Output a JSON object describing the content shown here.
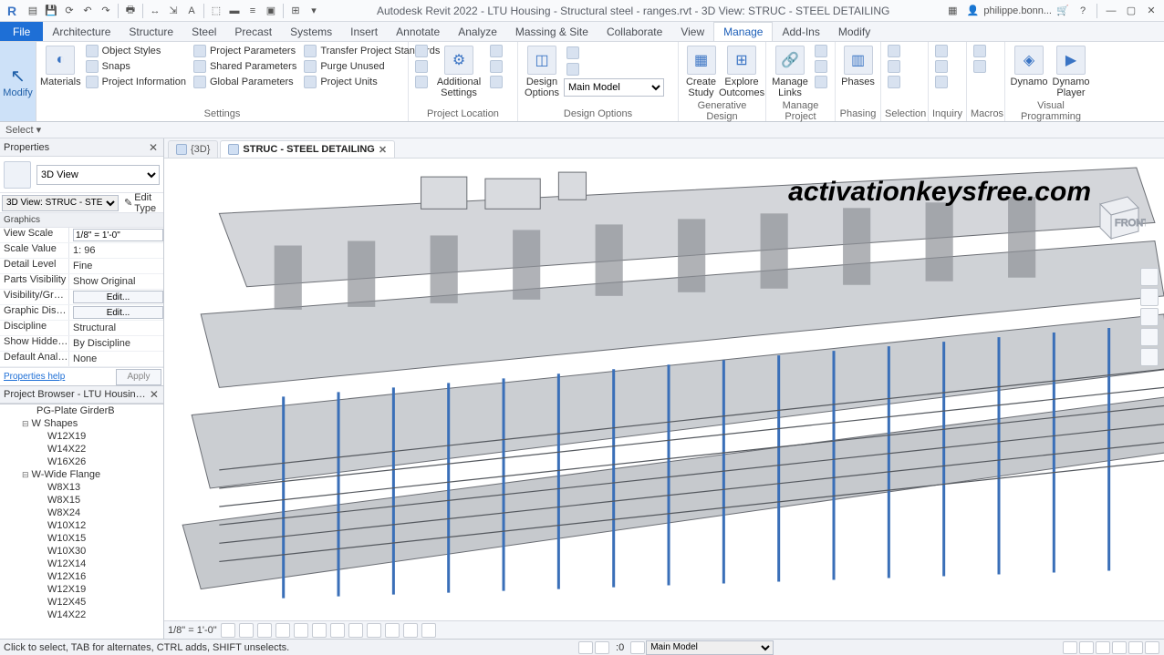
{
  "app": {
    "title": "Autodesk Revit 2022 - LTU Housing - Structural steel - ranges.rvt - 3D View: STRUC - STEEL DETAILING",
    "user": "philippe.bonn..."
  },
  "qat_icons": [
    "open",
    "save",
    "undo",
    "redo",
    "print",
    "measure",
    "dim",
    "text",
    "3d",
    "section",
    "thin",
    "close",
    "sync",
    "dropdown"
  ],
  "ribbon_tabs": [
    "Architecture",
    "Structure",
    "Steel",
    "Precast",
    "Systems",
    "Insert",
    "Annotate",
    "Analyze",
    "Massing & Site",
    "Collaborate",
    "View",
    "Manage",
    "Add-Ins",
    "Modify"
  ],
  "active_tab": "Manage",
  "file_tab": "File",
  "modify": {
    "label": "Modify",
    "select": "Select ▾"
  },
  "ribbon_panels": {
    "settings": {
      "title": "Settings",
      "materials": "Materials",
      "rows": [
        {
          "icon": "styles",
          "label": "Object  Styles"
        },
        {
          "icon": "snaps",
          "label": "Snaps"
        },
        {
          "icon": "info",
          "label": "Project  Information"
        },
        {
          "icon": "pparams",
          "label": "Project  Parameters"
        },
        {
          "icon": "sparams",
          "label": "Shared  Parameters"
        },
        {
          "icon": "gparams",
          "label": "Global  Parameters"
        },
        {
          "icon": "transfer",
          "label": "Transfer  Project Standards"
        },
        {
          "icon": "purge",
          "label": "Purge  Unused"
        },
        {
          "icon": "units",
          "label": "Project  Units"
        }
      ]
    },
    "project_location": {
      "title": "Project Location",
      "additional": "Additional\nSettings"
    },
    "design_options": {
      "title": "Design Options",
      "design": "Design\nOptions",
      "model": "Main Model"
    },
    "generative": {
      "title": "Generative Design",
      "create": "Create\nStudy",
      "explore": "Explore\nOutcomes"
    },
    "manage_project": {
      "title": "Manage Project",
      "links": "Manage\nLinks"
    },
    "phasing": {
      "title": "Phasing",
      "phases": "Phases"
    },
    "selection": {
      "title": "Selection"
    },
    "inquiry": {
      "title": "Inquiry"
    },
    "macros": {
      "title": "Macros"
    },
    "visual": {
      "title": "Visual Programming",
      "dynamo": "Dynamo",
      "player": "Dynamo\nPlayer"
    }
  },
  "properties": {
    "title": "Properties",
    "type": "3D View",
    "instance": "3D View: STRUC - STE",
    "edit_type": "Edit Type",
    "group": "Graphics",
    "rows": [
      {
        "label": "View Scale",
        "value": "1/8\" = 1'-0\"",
        "kind": "input"
      },
      {
        "label": "Scale Value",
        "value": "1: 96",
        "kind": "text"
      },
      {
        "label": "Detail Level",
        "value": "Fine",
        "kind": "text"
      },
      {
        "label": "Parts Visibility",
        "value": "Show Original",
        "kind": "text"
      },
      {
        "label": "Visibility/Grap...",
        "value": "Edit...",
        "kind": "button"
      },
      {
        "label": "Graphic Displ...",
        "value": "Edit...",
        "kind": "button"
      },
      {
        "label": "Discipline",
        "value": "Structural",
        "kind": "text"
      },
      {
        "label": "Show Hidden ...",
        "value": "By Discipline",
        "kind": "text"
      },
      {
        "label": "Default Analys...",
        "value": "None",
        "kind": "text"
      }
    ],
    "help": "Properties help",
    "apply": "Apply"
  },
  "browser": {
    "title": "Project Browser - LTU Housing - Str...",
    "items": [
      {
        "t": "leaf",
        "label": "PG-Plate GirderB",
        "indent": 40
      },
      {
        "t": "group",
        "label": "W Shapes"
      },
      {
        "t": "leaf",
        "label": "W12X19",
        "indent": 52
      },
      {
        "t": "leaf",
        "label": "W14X22",
        "indent": 52
      },
      {
        "t": "leaf",
        "label": "W16X26",
        "indent": 52
      },
      {
        "t": "group",
        "label": "W-Wide Flange"
      },
      {
        "t": "leaf",
        "label": "W8X13",
        "indent": 52
      },
      {
        "t": "leaf",
        "label": "W8X15",
        "indent": 52
      },
      {
        "t": "leaf",
        "label": "W8X24",
        "indent": 52
      },
      {
        "t": "leaf",
        "label": "W10X12",
        "indent": 52
      },
      {
        "t": "leaf",
        "label": "W10X15",
        "indent": 52
      },
      {
        "t": "leaf",
        "label": "W10X30",
        "indent": 52
      },
      {
        "t": "leaf",
        "label": "W12X14",
        "indent": 52
      },
      {
        "t": "leaf",
        "label": "W12X16",
        "indent": 52
      },
      {
        "t": "leaf",
        "label": "W12X19",
        "indent": 52
      },
      {
        "t": "leaf",
        "label": "W12X45",
        "indent": 52
      },
      {
        "t": "leaf",
        "label": "W14X22",
        "indent": 52
      }
    ]
  },
  "view_tabs": [
    {
      "label": "{3D}",
      "active": false
    },
    {
      "label": "STRUC - STEEL DETAILING",
      "active": true
    }
  ],
  "watermark": "activationkeysfree.com",
  "view_control": {
    "scale": "1/8\" = 1'-0\""
  },
  "status": {
    "hint": "Click to select, TAB for alternates, CTRL adds, SHIFT unselects.",
    "sel_count": ":0",
    "model": "Main Model"
  }
}
